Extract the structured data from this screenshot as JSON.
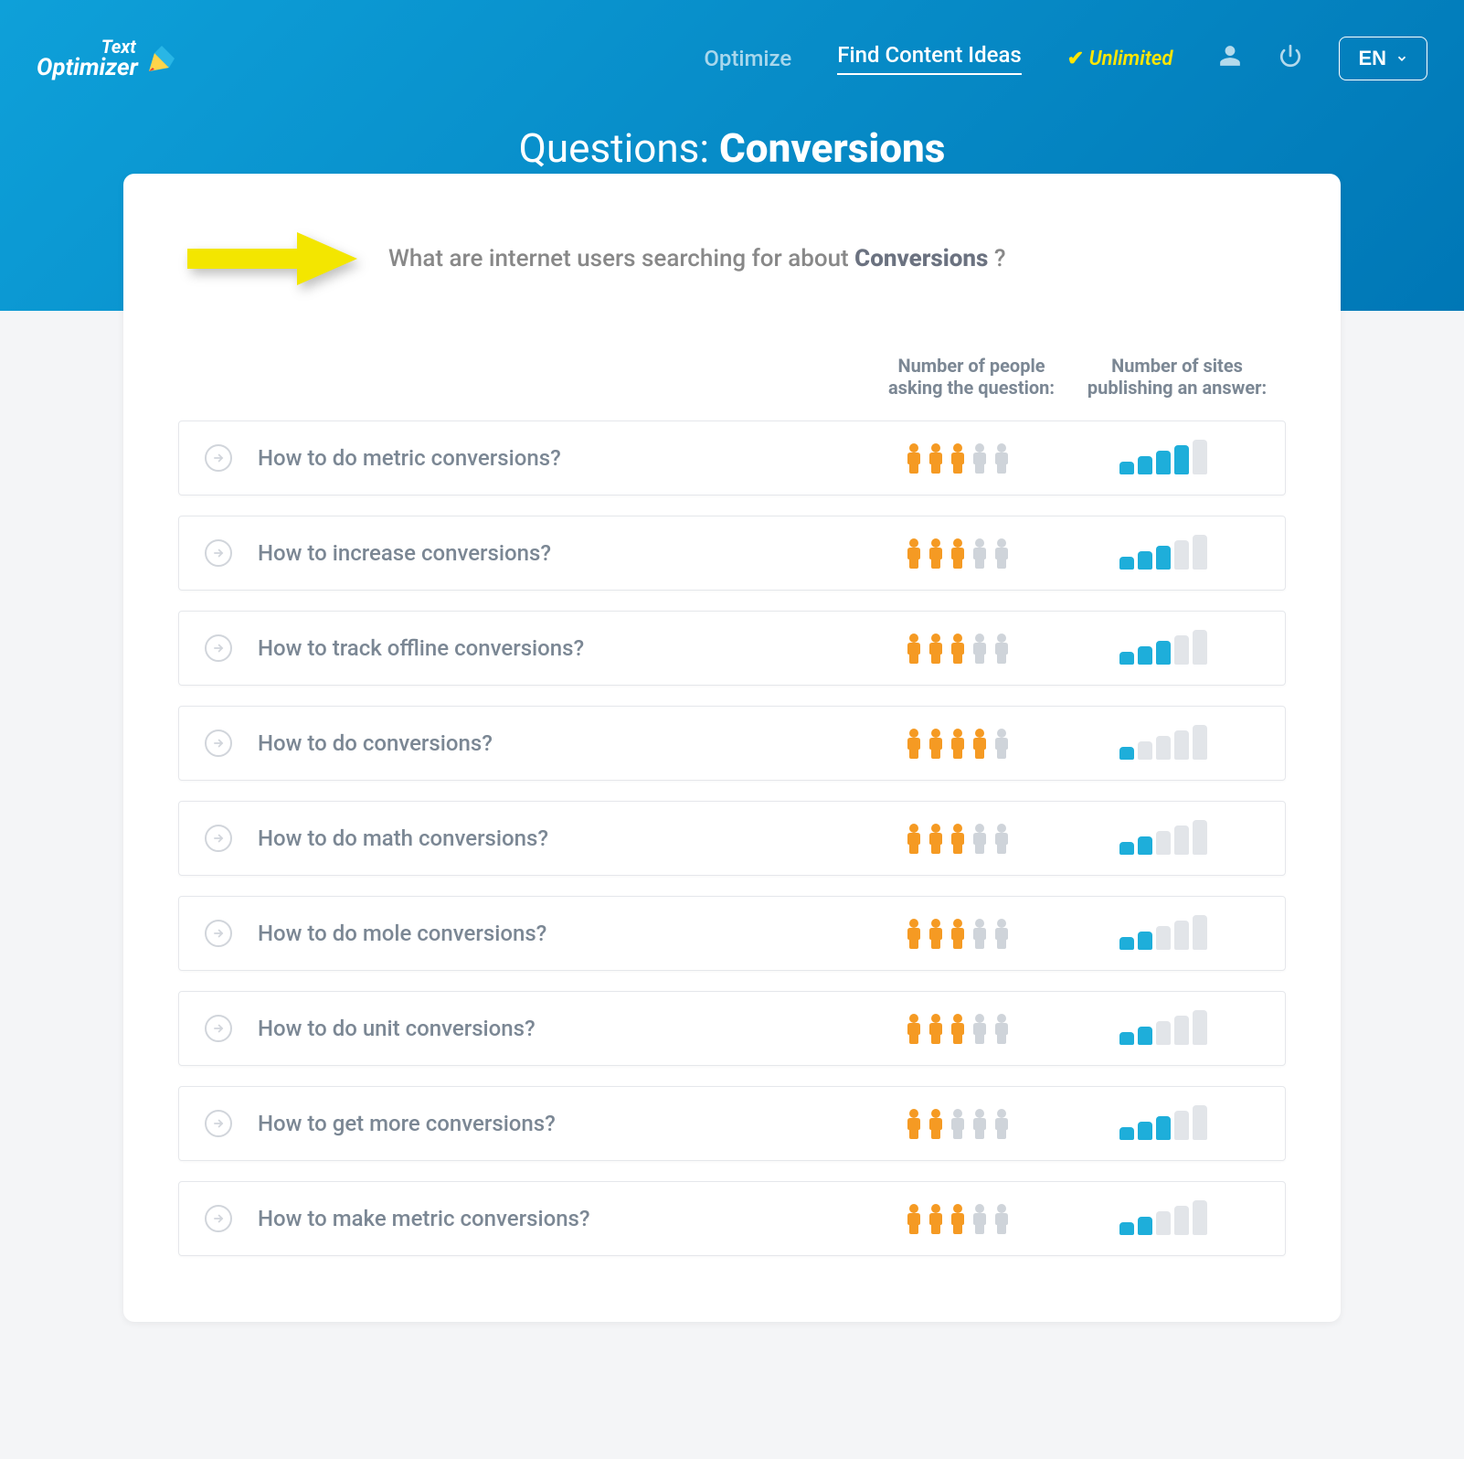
{
  "brand": {
    "line1": "Text",
    "line2": "Optimizer"
  },
  "nav": {
    "optimize": "Optimize",
    "find_ideas": "Find Content Ideas",
    "unlimited": "Unlimited",
    "lang": "EN"
  },
  "page_title": {
    "prefix": "Questions: ",
    "topic": "Conversions"
  },
  "subhead": {
    "prefix": "What are internet users searching for about ",
    "topic": "Conversions",
    "suffix": " ?"
  },
  "columns": {
    "q": "",
    "people": "Number of people asking the question:",
    "sites": "Number of sites publishing an answer:"
  },
  "questions": [
    {
      "text": "How to do metric conversions?",
      "people": 3,
      "sites": 4
    },
    {
      "text": "How to increase conversions?",
      "people": 3,
      "sites": 3
    },
    {
      "text": "How to track offline conversions?",
      "people": 3,
      "sites": 3
    },
    {
      "text": "How to do conversions?",
      "people": 4,
      "sites": 1
    },
    {
      "text": "How to do math conversions?",
      "people": 3,
      "sites": 2
    },
    {
      "text": "How to do mole conversions?",
      "people": 3,
      "sites": 2
    },
    {
      "text": "How to do unit conversions?",
      "people": 3,
      "sites": 2
    },
    {
      "text": "How to get more conversions?",
      "people": 2,
      "sites": 3
    },
    {
      "text": "How to make metric conversions?",
      "people": 3,
      "sites": 2
    }
  ],
  "colors": {
    "people_on": "#f59a23",
    "people_off": "#cfd4da",
    "bar_on": "#1eaeda",
    "bar_off": "#e2e5e9"
  }
}
